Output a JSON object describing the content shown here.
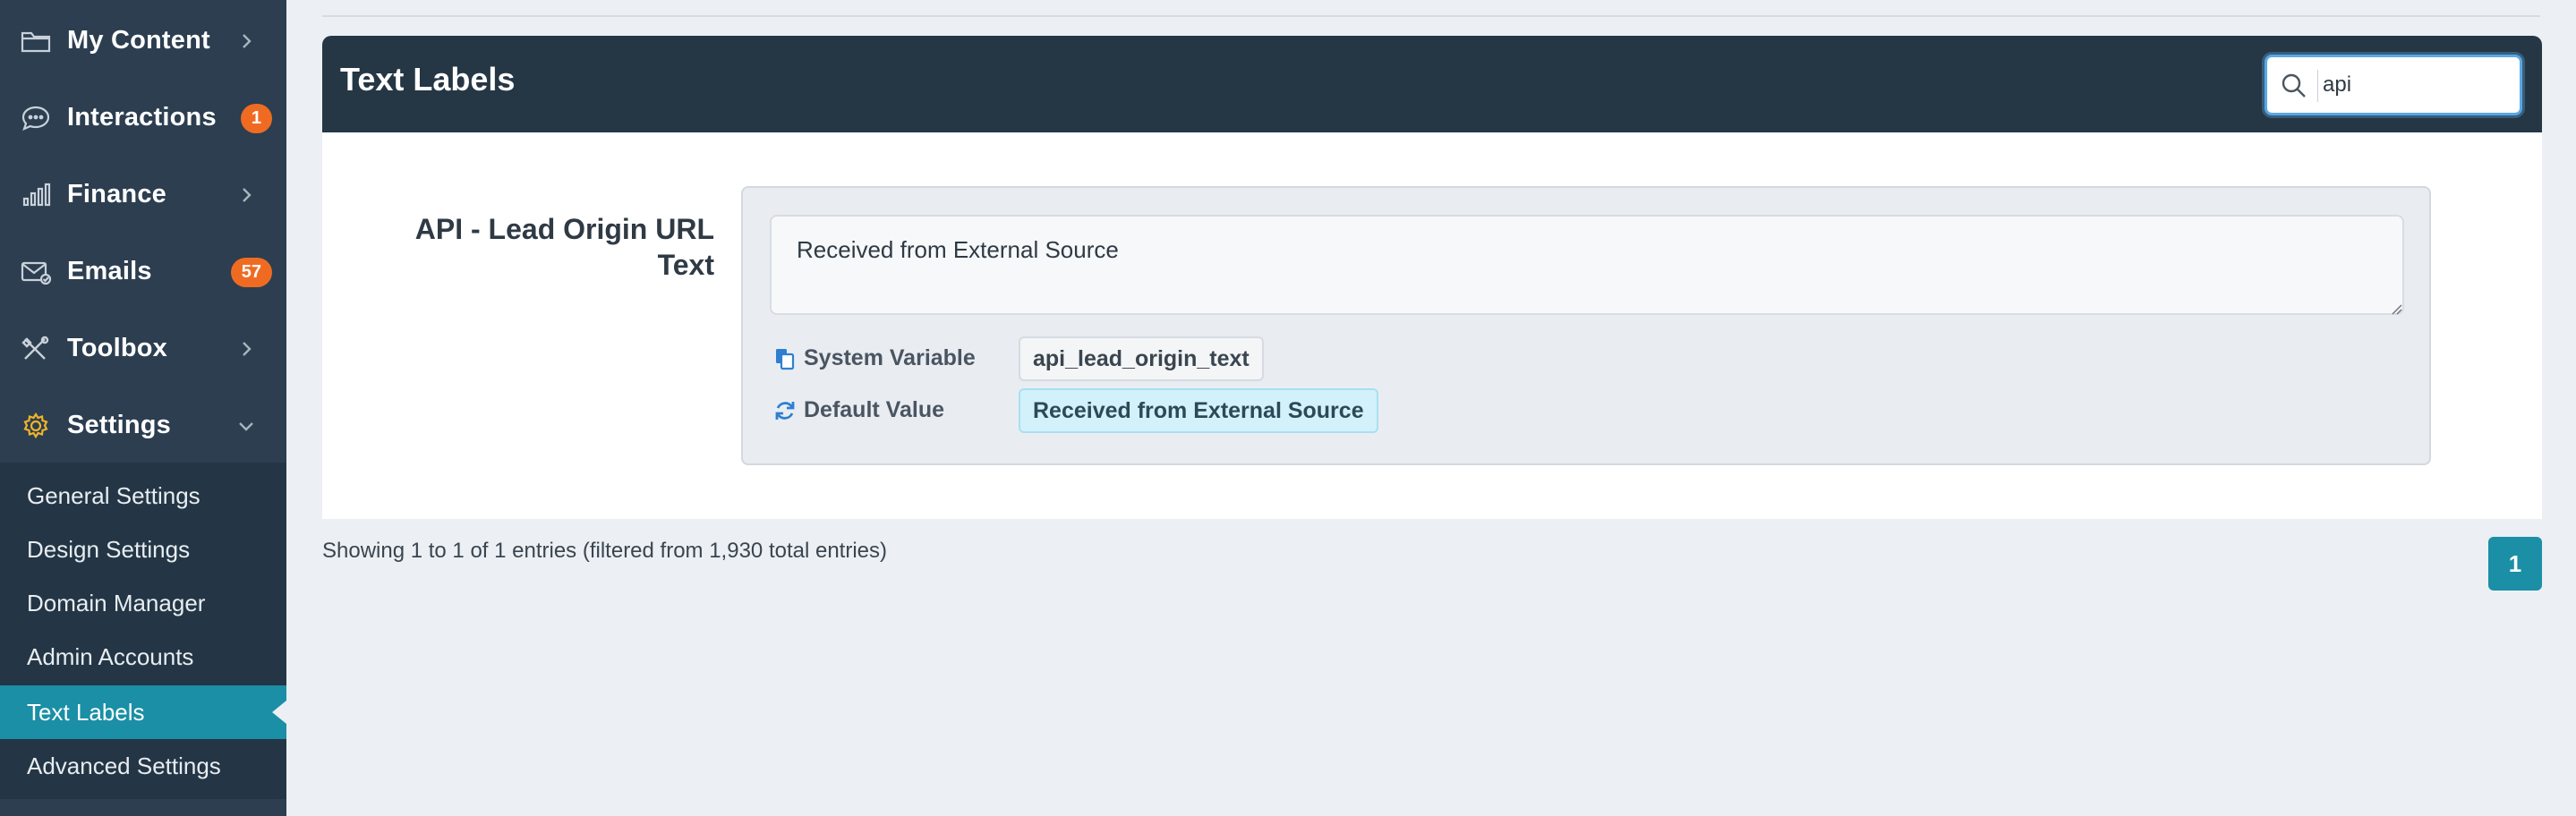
{
  "sidebar": {
    "items": [
      {
        "label": "My Content",
        "icon": "folder-icon",
        "has_chevron": true
      },
      {
        "label": "Interactions",
        "icon": "chat-icon",
        "badge": "1"
      },
      {
        "label": "Finance",
        "icon": "bar-chart-icon",
        "has_chevron": true
      },
      {
        "label": "Emails",
        "icon": "envelope-icon",
        "badge": "57"
      },
      {
        "label": "Toolbox",
        "icon": "tools-icon",
        "has_chevron": true
      },
      {
        "label": "Settings",
        "icon": "gear-icon",
        "expanded": true
      }
    ],
    "submenu": [
      {
        "label": "General Settings"
      },
      {
        "label": "Design Settings"
      },
      {
        "label": "Domain Manager"
      },
      {
        "label": "Admin Accounts"
      },
      {
        "label": "Text Labels",
        "active": true
      },
      {
        "label": "Advanced Settings"
      }
    ]
  },
  "panel": {
    "title": "Text Labels",
    "search": {
      "value": "api"
    }
  },
  "field": {
    "label": "API - Lead Origin URL Text",
    "value": "Received from External Source",
    "system_variable_label": "System Variable",
    "system_variable_value": "api_lead_origin_text",
    "default_value_label": "Default Value",
    "default_value": "Received from External Source"
  },
  "footer": {
    "entries_info": "Showing 1 to 1 of 1 entries (filtered from 1,930 total entries)",
    "page": "1"
  },
  "colors": {
    "sidebar_bg": "#2c3e50",
    "header_bg": "#253645",
    "accent": "#1a8fa6",
    "badge": "#f06b22",
    "gear_icon": "#f0b429"
  }
}
